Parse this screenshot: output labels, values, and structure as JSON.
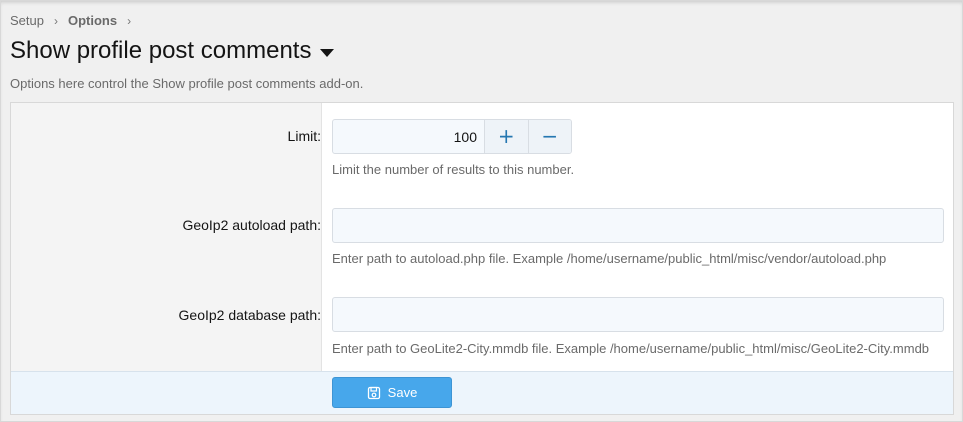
{
  "breadcrumb": {
    "items": [
      {
        "label": "Setup"
      },
      {
        "label": "Options"
      }
    ],
    "separator": "›"
  },
  "page": {
    "title": "Show profile post comments",
    "description": "Options here control the Show profile post comments add-on."
  },
  "form": {
    "limit": {
      "label": "Limit:",
      "value": "100",
      "increment_symbol": "+",
      "decrement_symbol": "−",
      "hint": "Limit the number of results to this number."
    },
    "autoload_path": {
      "label": "GeoIp2 autoload path:",
      "value": "",
      "placeholder": "",
      "hint": "Enter path to autoload.php file. Example /home/username/public_html/misc/vendor/autoload.php"
    },
    "database_path": {
      "label": "GeoIp2 database path:",
      "value": "",
      "placeholder": "",
      "hint": "Enter path to GeoLite2-City.mmdb file. Example /home/username/public_html/misc/GeoLite2-City.mmdb"
    }
  },
  "footer": {
    "save_label": "Save",
    "save_icon": "save-icon"
  },
  "colors": {
    "accent": "#47a7eb",
    "link": "#2577b1",
    "page_background": "#f0f0f0",
    "input_background": "#f5f9fd",
    "footer_background": "#edf5fc"
  }
}
